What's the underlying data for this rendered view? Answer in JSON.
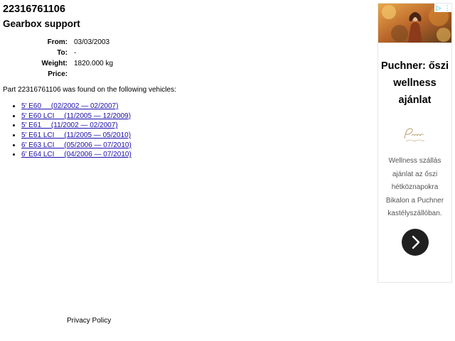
{
  "part": {
    "number": "22316761106",
    "name": "Gearbox support"
  },
  "specs": [
    {
      "label": "From:",
      "value": "03/03/2003"
    },
    {
      "label": "To:",
      "value": "-"
    },
    {
      "label": "Weight:",
      "value": "1820.000 kg"
    },
    {
      "label": "Price:",
      "value": ""
    }
  ],
  "found_text": "Part 22316761106 was found on the following vehicles:",
  "vehicles": [
    "5' E60     (02/2002 — 02/2007)",
    "5' E60 LCI     (11/2005 — 12/2009)",
    "5' E61     (11/2002 — 02/2007)",
    "5' E61 LCI     (11/2005 — 05/2010)",
    "6' E63 LCI     (05/2006 — 07/2010)",
    "6' E64 LCI     (04/2006 — 07/2010)"
  ],
  "footer": {
    "privacy_label": "Privacy Policy"
  },
  "ad": {
    "badges": [
      "▷",
      "⋮"
    ],
    "title": "Puchner: őszi wellness ajánlat",
    "logo_text": "Puchner",
    "body": "Wellness szállás ajánlat az őszi hétköznapokra Bikalon a Puchner kastélyszállóban.",
    "cta_icon": "chevron-right-icon"
  }
}
